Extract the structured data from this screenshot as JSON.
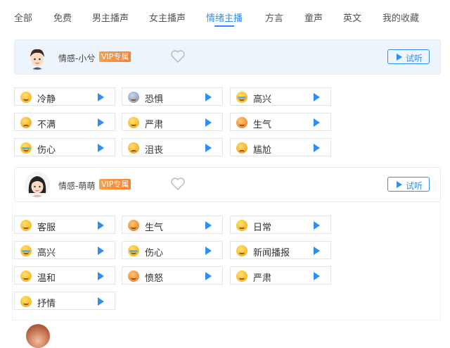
{
  "tabs": [
    "全部",
    "免费",
    "男主播声",
    "女主播声",
    "情绪主播",
    "方言",
    "童声",
    "英文",
    "我的收藏"
  ],
  "active_tab_index": 4,
  "colors": {
    "accent": "#2f8ef4",
    "vip_badge": "#f58231"
  },
  "anchors": [
    {
      "name": "情感-小兮",
      "badge": "VIP专属",
      "try_label": "试听",
      "emotions": [
        {
          "label": "冷静",
          "icon": "calm-emoji-icon"
        },
        {
          "label": "恐惧",
          "icon": "fear-emoji-icon"
        },
        {
          "label": "高兴",
          "icon": "laugh-emoji-icon"
        },
        {
          "label": "不满",
          "icon": "displeased-emoji-icon"
        },
        {
          "label": "严肃",
          "icon": "serious-emoji-icon"
        },
        {
          "label": "生气",
          "icon": "angry-emoji-icon"
        },
        {
          "label": "伤心",
          "icon": "cry-emoji-icon"
        },
        {
          "label": "沮丧",
          "icon": "frustrated-emoji-icon"
        },
        {
          "label": "尴尬",
          "icon": "embarrassed-emoji-icon"
        }
      ]
    },
    {
      "name": "情感-萌萌",
      "badge": "VIP专属",
      "try_label": "试听",
      "emotions": [
        {
          "label": "客服",
          "icon": "smile-emoji-icon"
        },
        {
          "label": "生气",
          "icon": "angry-emoji-icon"
        },
        {
          "label": "日常",
          "icon": "grin-emoji-icon"
        },
        {
          "label": "高兴",
          "icon": "laugh-emoji-icon"
        },
        {
          "label": "伤心",
          "icon": "cry-emoji-icon"
        },
        {
          "label": "新闻播报",
          "icon": "grin-emoji-icon"
        },
        {
          "label": "温和",
          "icon": "gentle-emoji-icon"
        },
        {
          "label": "愤怒",
          "icon": "angry-emoji-icon"
        },
        {
          "label": "严肃",
          "icon": "serious-emoji-icon"
        },
        {
          "label": "抒情",
          "icon": "smile-emoji-icon"
        }
      ]
    }
  ]
}
